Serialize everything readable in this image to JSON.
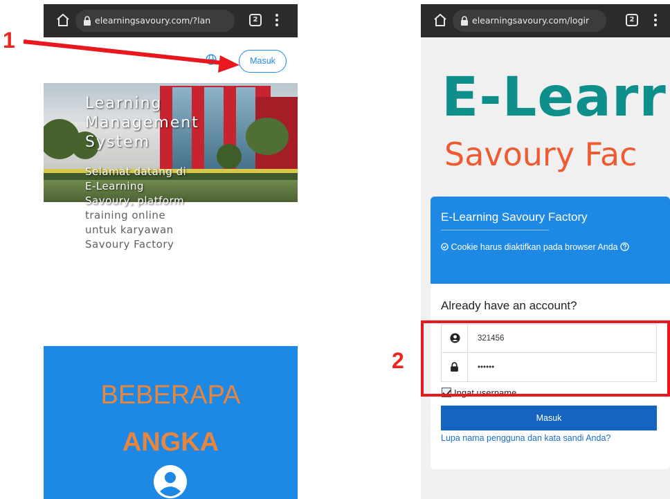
{
  "left_phone": {
    "browser": {
      "url": "elearningsavoury.com/?lan",
      "tab_count": "2"
    },
    "header": {
      "login_button": "Masuk"
    },
    "hero": {
      "title_lines": [
        "Learning",
        "Management",
        "System"
      ],
      "subtitle_on_image": [
        "Selamat datang di",
        "E-Learning",
        "Savoury, platform"
      ],
      "subtitle_below": [
        "training online",
        "untuk karyawan",
        "Savoury Factory"
      ]
    },
    "stats": {
      "line1": "BEBERAPA",
      "line2": "ANGKA"
    }
  },
  "right_phone": {
    "browser": {
      "url": "elearningsavoury.com/logir",
      "tab_count": "2"
    },
    "brand": {
      "line1": "E-Learr",
      "line2": "Savoury Fac"
    },
    "card": {
      "title": "E-Learning Savoury Factory",
      "cookie_notice": "Cookie harus diaktifkan pada browser Anda",
      "heading": "Already have an account?",
      "username_value": "321456",
      "password_value": "••••••",
      "remember_label": "Ingat username",
      "remember_checked": true,
      "login_button": "Masuk",
      "forgot_link": "Lupa nama pengguna dan kata sandi Anda?"
    }
  },
  "annotations": {
    "step1": "1",
    "step2": "2",
    "color": "#e8181e"
  },
  "colors": {
    "primary_blue": "#1e88e5",
    "button_blue": "#1565c0",
    "teal": "#0f8f8b",
    "orange": "#ef5a30",
    "stat_orange": "#e8863e"
  }
}
